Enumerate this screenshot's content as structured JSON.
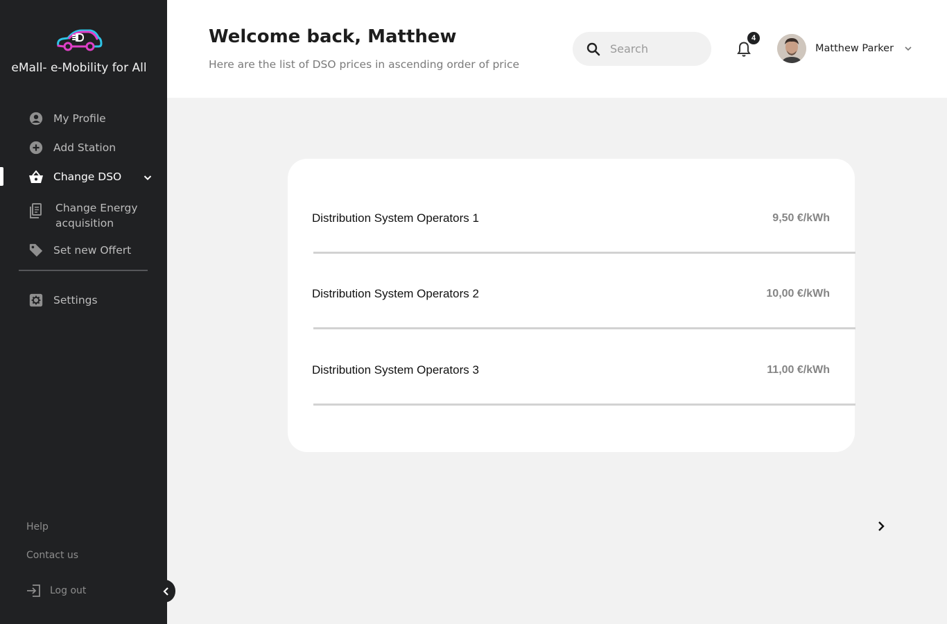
{
  "brand": {
    "name": "eMall- e-Mobility for All",
    "logo_icon": "car-plug-icon",
    "accent": "#e040c8"
  },
  "sidebar": {
    "items": [
      {
        "label": "My Profile",
        "icon": "user-circle-icon"
      },
      {
        "label": "Add Station",
        "icon": "plus-circle-icon"
      },
      {
        "label": "Change DSO",
        "icon": "basket-icon",
        "active": true
      },
      {
        "label": "Change Energy acquisition",
        "icon": "document-icon"
      },
      {
        "label": "Set new Offert",
        "icon": "tag-icon"
      }
    ],
    "settings": {
      "label": "Settings",
      "icon": "gear-icon"
    },
    "footer": {
      "help": "Help",
      "contact": "Contact us",
      "logout": "Log out"
    }
  },
  "header": {
    "title": "Welcome back, Matthew",
    "subtitle": "Here are the list of DSO prices in ascending order of price",
    "search": {
      "placeholder": "Search",
      "value": ""
    },
    "notifications": {
      "count": "4"
    },
    "user": {
      "name": "Matthew Parker"
    }
  },
  "dso_list": [
    {
      "name": "Distribution System Operators 1",
      "price": "9,50 €/kWh"
    },
    {
      "name": "Distribution System Operators 2",
      "price": "10,00 €/kWh"
    },
    {
      "name": "Distribution System Operators 3",
      "price": "11,00 €/kWh"
    }
  ]
}
